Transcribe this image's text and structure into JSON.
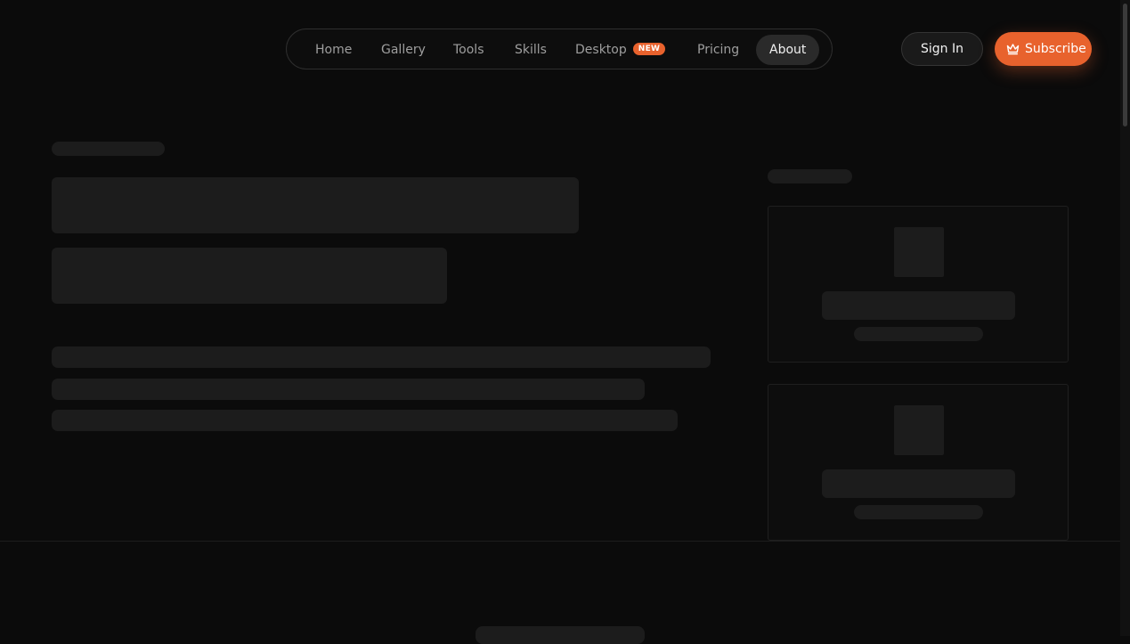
{
  "nav": {
    "items": [
      {
        "label": "Home"
      },
      {
        "label": "Gallery"
      },
      {
        "label": "Tools"
      },
      {
        "label": "Skills"
      },
      {
        "label": "Desktop",
        "badge": "NEW"
      },
      {
        "label": "Pricing"
      },
      {
        "label": "About",
        "active": true
      }
    ]
  },
  "actions": {
    "signin_label": "Sign In",
    "subscribe_label": "Subscribe",
    "subscribe_icon": "crown-icon"
  },
  "colors": {
    "accent": "#e8622d",
    "background": "#0b0b0b",
    "skeleton": "#1c1c1c"
  }
}
